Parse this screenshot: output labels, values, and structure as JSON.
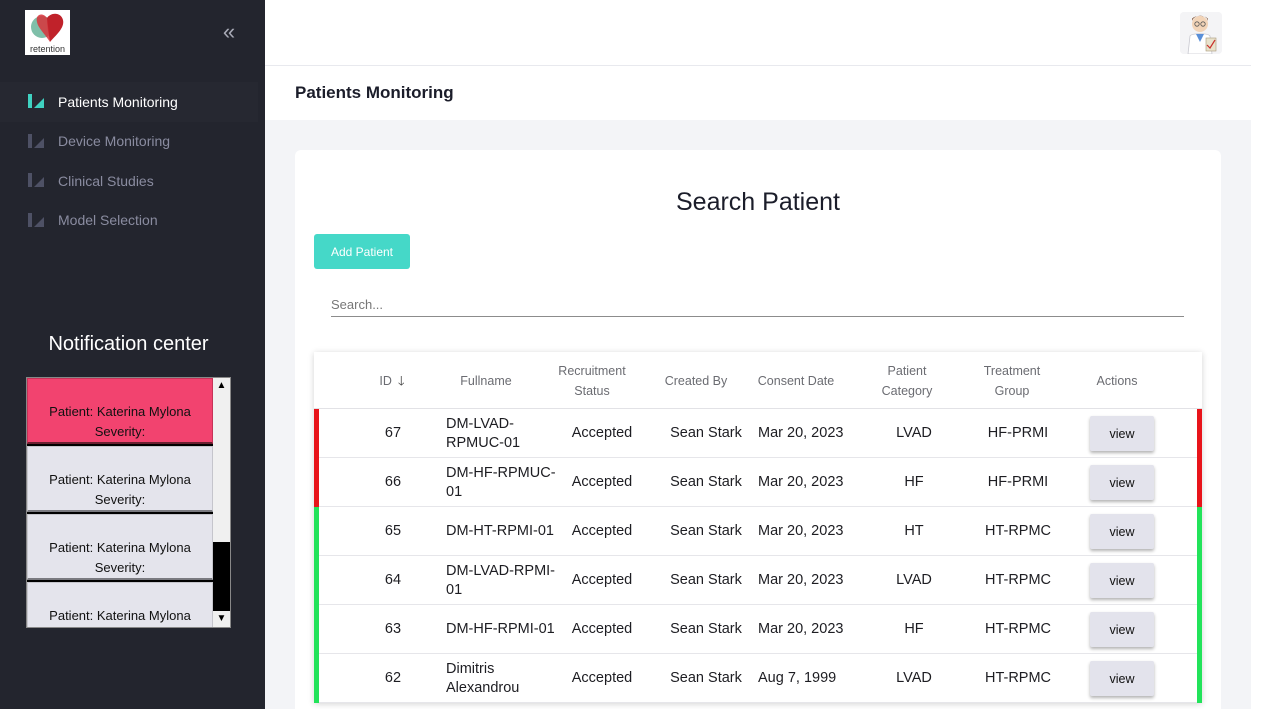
{
  "brand": {
    "logo_text": "retention"
  },
  "sidebar": {
    "collapse_icon": "double-chevron-left-icon",
    "items": [
      {
        "label": "Patients Monitoring",
        "active": true
      },
      {
        "label": "Device Monitoring",
        "active": false
      },
      {
        "label": "Clinical Studies",
        "active": false
      },
      {
        "label": "Model Selection",
        "active": false
      }
    ]
  },
  "notifications": {
    "title": "Notification center",
    "items": [
      {
        "patient": "Patient: Katerina Mylona",
        "severity": "Severity:",
        "highlight": true
      },
      {
        "patient": "Patient: Katerina Mylona",
        "severity": "Severity:",
        "highlight": false
      },
      {
        "patient": "Patient: Katerina Mylona",
        "severity": "Severity:",
        "highlight": false
      },
      {
        "patient": "Patient: Katerina Mylona",
        "severity": "",
        "highlight": false
      }
    ]
  },
  "header": {
    "page_title": "Patients Monitoring",
    "avatar_icon": "doctor-avatar-icon"
  },
  "search_card": {
    "title": "Search Patient",
    "add_button": "Add Patient",
    "search_placeholder": "Search..."
  },
  "table": {
    "columns": [
      "ID",
      "Fullname",
      "Recruitment Status",
      "Created By",
      "Consent Date",
      "Patient Category",
      "Treatment Group",
      "Actions"
    ],
    "rows": [
      {
        "id": "67",
        "fullname": "DM-LVAD-RPMUC-01",
        "status": "Accepted",
        "created_by": "Sean Stark",
        "consent_date": "Mar 20, 2023",
        "category": "LVAD",
        "group": "HF-PRMI",
        "action": "view",
        "flag": "red"
      },
      {
        "id": "66",
        "fullname": "DM-HF-RPMUC-01",
        "status": "Accepted",
        "created_by": "Sean Stark",
        "consent_date": "Mar 20, 2023",
        "category": "HF",
        "group": "HF-PRMI",
        "action": "view",
        "flag": "red"
      },
      {
        "id": "65",
        "fullname": "DM-HT-RPMI-01",
        "status": "Accepted",
        "created_by": "Sean Stark",
        "consent_date": "Mar 20, 2023",
        "category": "HT",
        "group": "HT-RPMC",
        "action": "view",
        "flag": "green"
      },
      {
        "id": "64",
        "fullname": "DM-LVAD-RPMI-01",
        "status": "Accepted",
        "created_by": "Sean Stark",
        "consent_date": "Mar 20, 2023",
        "category": "LVAD",
        "group": "HT-RPMC",
        "action": "view",
        "flag": "green"
      },
      {
        "id": "63",
        "fullname": "DM-HF-RPMI-01",
        "status": "Accepted",
        "created_by": "Sean Stark",
        "consent_date": "Mar 20, 2023",
        "category": "HF",
        "group": "HT-RPMC",
        "action": "view",
        "flag": "green"
      },
      {
        "id": "62",
        "fullname": "Dimitris Alexandrou",
        "status": "Accepted",
        "created_by": "Sean Stark",
        "consent_date": "Aug 7, 1999",
        "category": "LVAD",
        "group": "HT-RPMC",
        "action": "view",
        "flag": "green"
      }
    ]
  },
  "colors": {
    "sidebar_bg": "#23252e",
    "accent_teal": "#45d8c8",
    "alert_pink": "#f2436f",
    "flag_red": "#e8141a",
    "flag_green": "#22e35a"
  }
}
